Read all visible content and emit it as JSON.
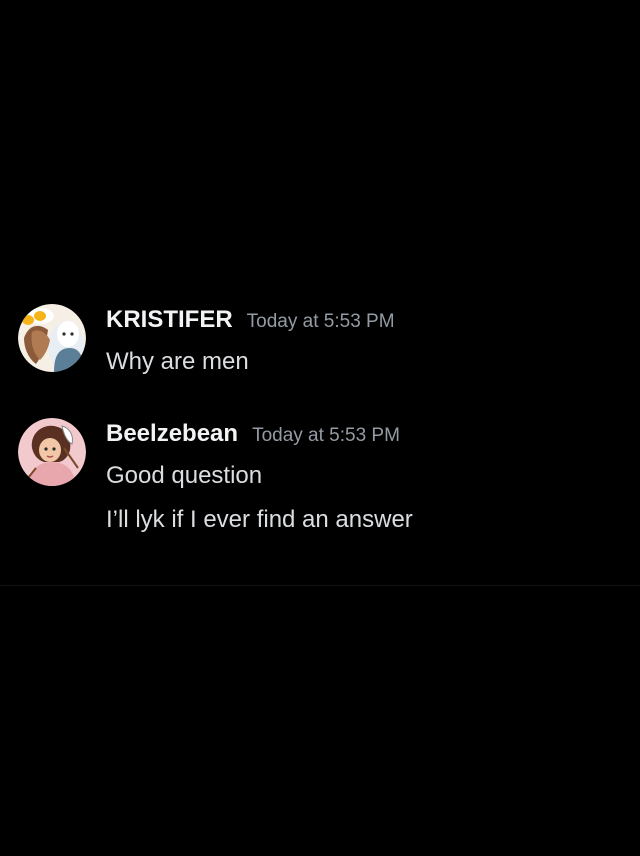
{
  "messages": [
    {
      "username": "KRISTIFER",
      "timestamp": "Today at 5:53 PM",
      "avatar_icon": "avatar-kristifer",
      "lines": [
        "Why are men"
      ]
    },
    {
      "username": "Beelzebean",
      "timestamp": "Today at 5:53 PM",
      "avatar_icon": "avatar-beelzebean",
      "lines": [
        "Good question",
        "I’ll lyk if I ever find an answer"
      ]
    }
  ],
  "colors": {
    "background": "#000000",
    "username": "#f2f3f5",
    "timestamp": "#949ba4",
    "message_text": "#dbdee1"
  }
}
